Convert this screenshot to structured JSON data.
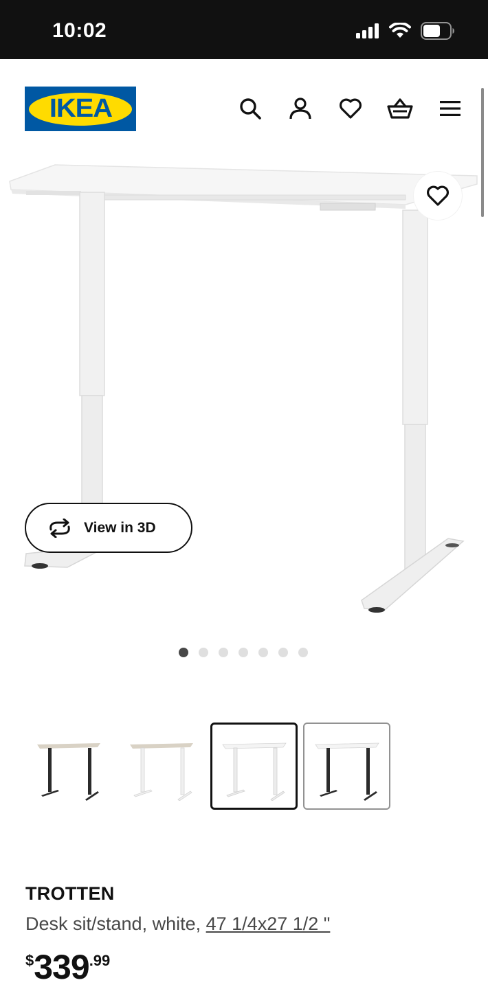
{
  "status_bar": {
    "time": "10:02"
  },
  "header": {
    "logo_text": "IKEA",
    "icons": [
      "search-icon",
      "account-icon",
      "heart-icon",
      "basket-icon",
      "menu-icon"
    ]
  },
  "gallery": {
    "view_3d_label": "View in 3D",
    "slide_count": 7,
    "active_slide": 1
  },
  "variants": [
    {
      "name": "beige-black",
      "top": "#d9d2c5",
      "legs": "#2b2b2b"
    },
    {
      "name": "beige-white",
      "top": "#d9d2c5",
      "legs": "#f0f0f0"
    },
    {
      "name": "white",
      "top": "#f4f4f4",
      "legs": "#ececec",
      "selected": true
    },
    {
      "name": "white-anthracite",
      "top": "#f4f4f4",
      "legs": "#2b2b2b"
    }
  ],
  "product": {
    "name": "TROTTEN",
    "description": "Desk sit/stand, white,",
    "size_link": "47 1/4x27 1/2 \"",
    "price": {
      "currency": "$",
      "integer": "339",
      "decimal": ".99"
    }
  },
  "colors": {
    "ikea_blue": "#0058a3",
    "ikea_yellow": "#ffdb00"
  }
}
